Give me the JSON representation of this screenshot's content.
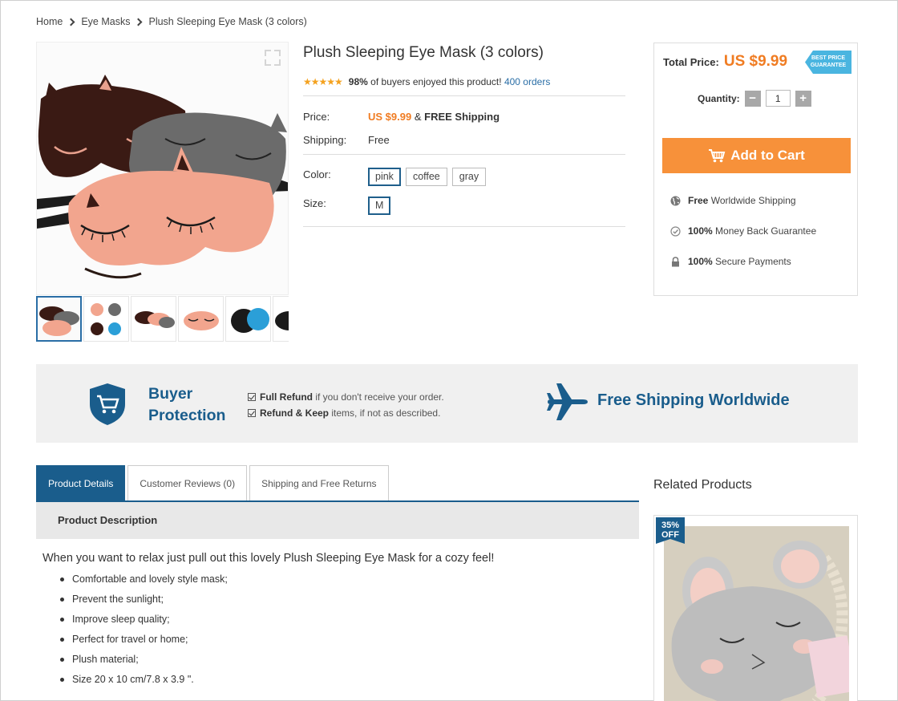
{
  "breadcrumb": {
    "home": "Home",
    "category": "Eye Masks",
    "current": "Plush Sleeping Eye Mask (3 colors)"
  },
  "product": {
    "title": "Plush Sleeping Eye Mask (3 colors)",
    "rating": 4.5,
    "rating_percent": "98%",
    "rating_text": "of buyers enjoyed this product!",
    "orders": "400 orders",
    "price_label": "Price:",
    "price_value": "US $9.99",
    "price_sep": "&",
    "free_shipping": "FREE Shipping",
    "shipping_label": "Shipping:",
    "shipping_value": "Free",
    "color_label": "Color:",
    "colors": [
      "pink",
      "coffee",
      "gray"
    ],
    "selected_color": "pink",
    "size_label": "Size:",
    "sizes": [
      "M"
    ]
  },
  "buybox": {
    "total_label": "Total Price:",
    "total_price": "US $9.99",
    "badge_line1": "BEST PRICE",
    "badge_line2": "GUARANTEE",
    "quantity_label": "Quantity:",
    "quantity": "1",
    "minus": "−",
    "plus": "+",
    "cart_label": "Add to Cart",
    "features": [
      {
        "bold": "Free",
        "text": "Worldwide Shipping",
        "icon": "globe-icon"
      },
      {
        "bold": "100%",
        "text": "Money Back Guarantee",
        "icon": "check-circle-icon"
      },
      {
        "bold": "100%",
        "text": "Secure Payments",
        "icon": "lock-icon"
      }
    ]
  },
  "banner": {
    "protection_line1": "Buyer",
    "protection_line2": "Protection",
    "item1_bold": "Full Refund",
    "item1_text": "if you don't receive your order.",
    "item2_bold": "Refund & Keep",
    "item2_text": "items, if not as described.",
    "free_shipping": "Free Shipping Worldwide"
  },
  "tabs": [
    {
      "label": "Product Details",
      "active": true
    },
    {
      "label": "Customer Reviews (0)",
      "active": false
    },
    {
      "label": "Shipping and Free Returns",
      "active": false
    }
  ],
  "description": {
    "heading": "Product Description",
    "intro": "When you want to relax just pull out this lovely Plush Sleeping Eye Mask for a cozy feel!",
    "bullets": [
      "Comfortable and lovely style mask;",
      "Prevent the sunlight;",
      "Improve sleep quality;",
      "Perfect for travel or home;",
      "Plush material;",
      "Size 20 x 10 cm/7.8 x 3.9 \"."
    ]
  },
  "related": {
    "title": "Related Products",
    "discount_value": "35%",
    "discount_label": "OFF"
  },
  "colors": {
    "accent_blue": "#1a5d8c",
    "price_orange": "#f07c22",
    "cart_orange": "#f7913a"
  }
}
